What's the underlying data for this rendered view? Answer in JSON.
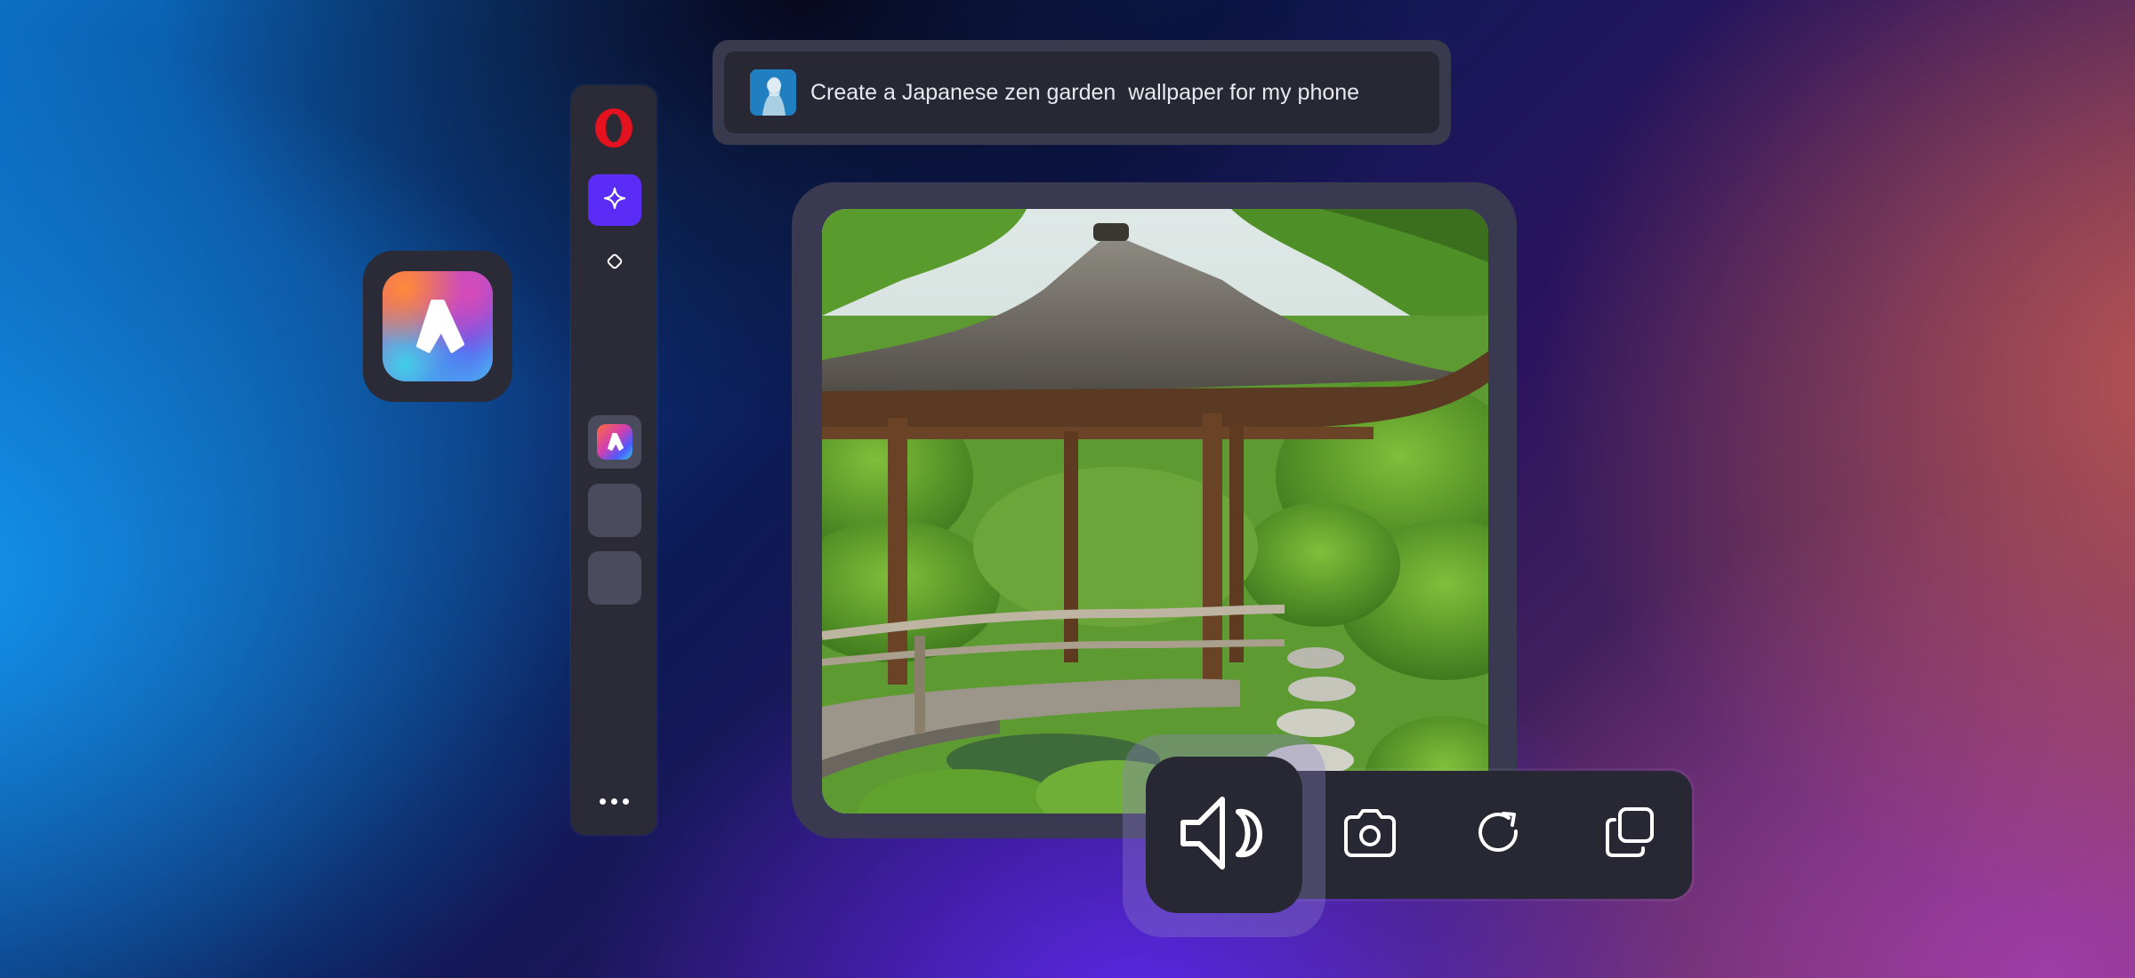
{
  "prompt": {
    "text": "Create a Japanese zen garden  wallpaper for my phone",
    "avatar_icon": "user-avatar"
  },
  "sidebar": {
    "logo_icon": "opera-logo-icon",
    "items": [
      {
        "icon": "sparkle-icon",
        "active": true
      },
      {
        "icon": "diamond-icon",
        "active": false
      },
      {
        "icon": "aria-app-icon",
        "active": false
      },
      {
        "icon": "empty-slot",
        "active": false
      },
      {
        "icon": "empty-slot",
        "active": false
      }
    ],
    "more_icon": "more-dots-icon"
  },
  "floating_app": {
    "icon": "aria-app-icon"
  },
  "generated_image": {
    "subject": "zen-garden-pavilion-image"
  },
  "toolbar": {
    "buttons": [
      "speaker-icon",
      "camera-icon",
      "refresh-icon",
      "copy-icon"
    ]
  },
  "colors": {
    "accent": "#5b2cf5",
    "panel": "#2a2b36",
    "opera_red": "#e3121e"
  }
}
